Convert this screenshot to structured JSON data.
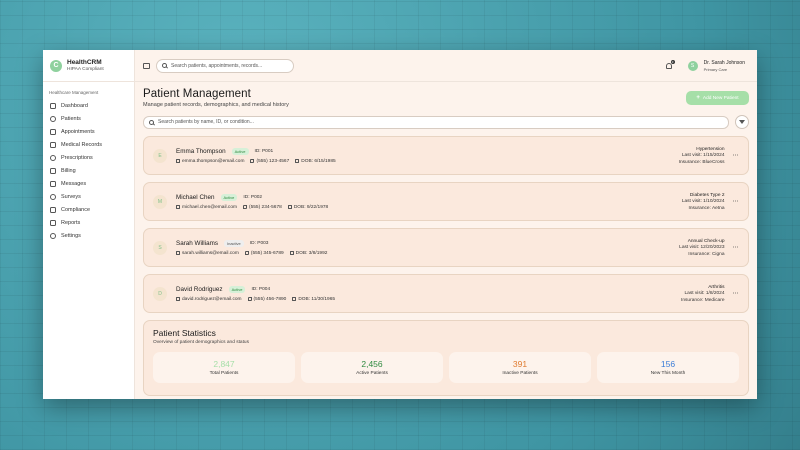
{
  "brand": {
    "name": "HealthCRM",
    "subtitle": "HIPAA Compliant",
    "logo_letter": "C"
  },
  "sidebar": {
    "section_title": "Healthcare Management",
    "items": [
      {
        "label": "Dashboard",
        "icon": "home-icon"
      },
      {
        "label": "Patients",
        "icon": "users-icon"
      },
      {
        "label": "Appointments",
        "icon": "calendar-icon"
      },
      {
        "label": "Medical Records",
        "icon": "file-icon"
      },
      {
        "label": "Prescriptions",
        "icon": "pill-icon"
      },
      {
        "label": "Billing",
        "icon": "credit-card-icon"
      },
      {
        "label": "Messages",
        "icon": "message-icon"
      },
      {
        "label": "Surveys",
        "icon": "survey-icon"
      },
      {
        "label": "Compliance",
        "icon": "shield-icon"
      },
      {
        "label": "Reports",
        "icon": "chart-icon"
      },
      {
        "label": "Settings",
        "icon": "gear-icon"
      }
    ]
  },
  "topbar": {
    "search_placeholder": "Search patients, appointments, records...",
    "notification_count": "3",
    "user": {
      "initials": "S",
      "name": "Dr. Sarah Johnson",
      "role": "Primary Care"
    }
  },
  "page": {
    "title": "Patient Management",
    "subtitle": "Manage patient records, demographics, and medical history",
    "add_button": "Add New Patient",
    "search_placeholder": "Search patients by name, ID, or condition..."
  },
  "patients": [
    {
      "initial": "E",
      "name": "Emma Thompson",
      "status": "Active",
      "id": "ID: P001",
      "email": "emma.thompson@email.com",
      "phone": "(555) 123-4567",
      "dob": "DOB: 6/15/1985",
      "condition": "Hypertension",
      "last_visit": "Last visit: 1/15/2024",
      "insurance": "Insurance: BlueCross"
    },
    {
      "initial": "M",
      "name": "Michael Chen",
      "status": "Active",
      "id": "ID: P002",
      "email": "michael.chen@email.com",
      "phone": "(555) 234-5678",
      "dob": "DOB: 9/22/1978",
      "condition": "Diabetes Type 2",
      "last_visit": "Last visit: 1/10/2024",
      "insurance": "Insurance: Aetna"
    },
    {
      "initial": "S",
      "name": "Sarah Williams",
      "status": "Inactive",
      "id": "ID: P003",
      "email": "sarah.williams@email.com",
      "phone": "(555) 345-6789",
      "dob": "DOB: 3/8/1992",
      "condition": "Annual Check-up",
      "last_visit": "Last visit: 12/20/2023",
      "insurance": "Insurance: Cigna"
    },
    {
      "initial": "D",
      "name": "David Rodriguez",
      "status": "Active",
      "id": "ID: P004",
      "email": "david.rodriguez@email.com",
      "phone": "(555) 456-7890",
      "dob": "DOB: 11/30/1965",
      "condition": "Arthritis",
      "last_visit": "Last visit: 1/8/2024",
      "insurance": "Insurance: Medicare"
    }
  ],
  "stats": {
    "title": "Patient Statistics",
    "subtitle": "Overview of patient demographics and status",
    "items": [
      {
        "value": "2,847",
        "label": "Total Patients",
        "color": "#a6dfa8"
      },
      {
        "value": "2,456",
        "label": "Active Patients",
        "color": "#2f8a3f"
      },
      {
        "value": "391",
        "label": "Inactive Patients",
        "color": "#e07b30"
      },
      {
        "value": "156",
        "label": "New This Month",
        "color": "#3b7dd8"
      }
    ]
  }
}
